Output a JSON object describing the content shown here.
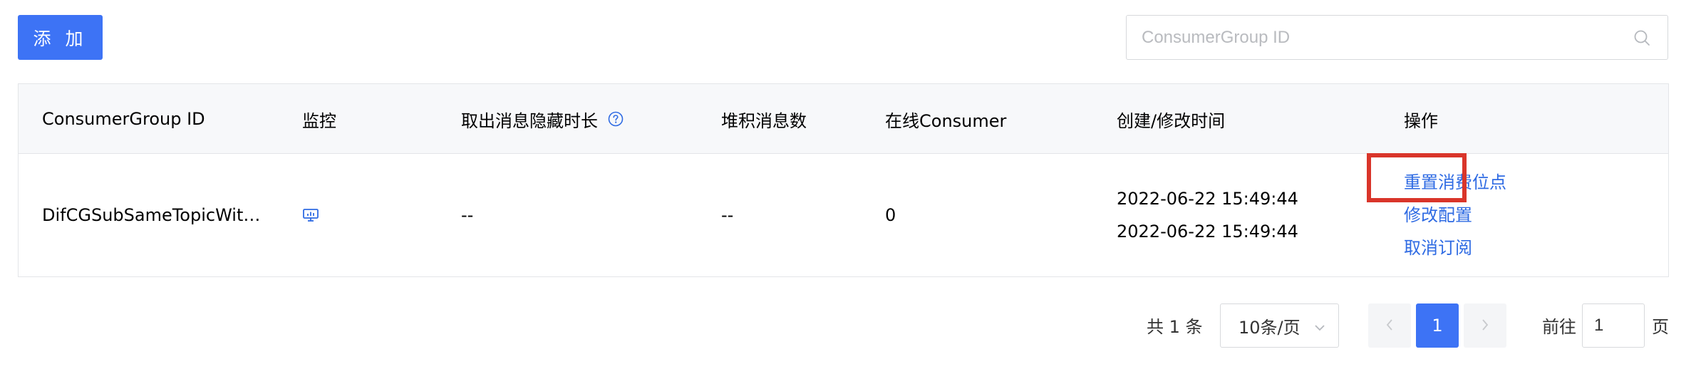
{
  "toolbar": {
    "add_label": "添 加",
    "search_placeholder": "ConsumerGroup ID",
    "search_value": ""
  },
  "table": {
    "columns": [
      "ConsumerGroup ID",
      "监控",
      "取出消息隐藏时长",
      "堆积消息数",
      "在线Consumer",
      "创建/修改时间",
      "操作"
    ],
    "rows": [
      {
        "group_id": "DifCGSubSameTopicWit…",
        "invisible_duration": "--",
        "backlog": "--",
        "online_consumer": "0",
        "created_time": "2022-06-22 15:49:44",
        "modified_time": "2022-06-22 15:49:44",
        "actions": [
          "重置消费位点",
          "修改配置",
          "取消订阅"
        ]
      }
    ]
  },
  "pagination": {
    "total_text": "共 1 条",
    "page_size": "10条/页",
    "current_page": "1",
    "goto_prefix": "前往",
    "goto_value": "1",
    "goto_suffix": "页"
  },
  "colors": {
    "primary": "#3d73f5",
    "link": "#2f6be3",
    "highlight_border": "#d9352a"
  },
  "icons": [
    "search-icon",
    "help-circle-icon",
    "monitor-icon",
    "chevron-down-icon",
    "chevron-left-icon",
    "chevron-right-icon"
  ]
}
